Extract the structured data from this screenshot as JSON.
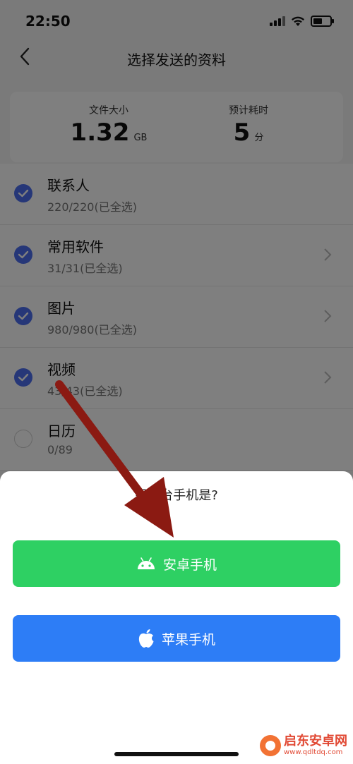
{
  "status": {
    "time": "22:50"
  },
  "nav": {
    "title": "选择发送的资料"
  },
  "summary": {
    "size_label": "文件大小",
    "size_value": "1.32",
    "size_unit": "GB",
    "time_label": "预计耗时",
    "time_value": "5",
    "time_unit": "分"
  },
  "list": [
    {
      "title": "联系人",
      "sub": "220/220(已全选)",
      "checked": true,
      "chevron": false
    },
    {
      "title": "常用软件",
      "sub": "31/31(已全选)",
      "checked": true,
      "chevron": true
    },
    {
      "title": "图片",
      "sub": "980/980(已全选)",
      "checked": true,
      "chevron": true
    },
    {
      "title": "视频",
      "sub": "43/43(已全选)",
      "checked": true,
      "chevron": true
    },
    {
      "title": "日历",
      "sub": "0/89",
      "checked": false,
      "chevron": false
    }
  ],
  "sheet": {
    "title": "另一台手机是?",
    "android_label": "安卓手机",
    "apple_label": "苹果手机"
  },
  "watermark": {
    "name": "启东安卓网",
    "url": "www.qdltdq.com"
  },
  "colors": {
    "check": "#4c6ff0",
    "android": "#2ed063",
    "apple": "#2d7df6",
    "arrow": "#8b1a12"
  }
}
